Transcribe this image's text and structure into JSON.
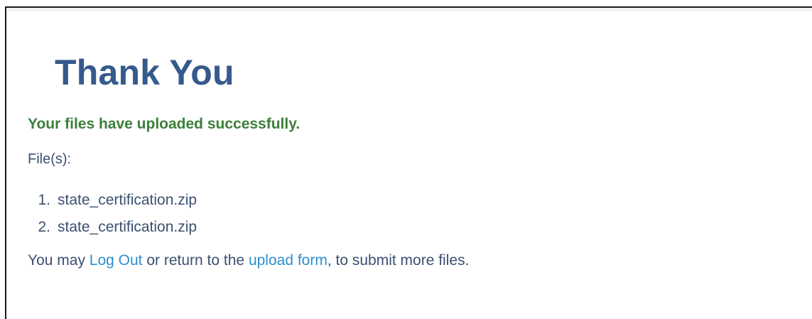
{
  "page": {
    "title": "Thank You",
    "success_message": "Your files have uploaded successfully.",
    "files_label": "File(s):",
    "files": [
      {
        "number": "1.",
        "name": "state_certification.zip"
      },
      {
        "number": "2.",
        "name": "state_certification.zip"
      }
    ],
    "footer": {
      "prefix": "You may ",
      "logout_link": "Log Out",
      "middle": " or return to the ",
      "upload_link": "upload form",
      "suffix": ", to submit more files."
    }
  },
  "colors": {
    "title": "#355a8c",
    "success": "#3c7f3a",
    "text": "#3b5071",
    "link": "#2c8fce"
  }
}
